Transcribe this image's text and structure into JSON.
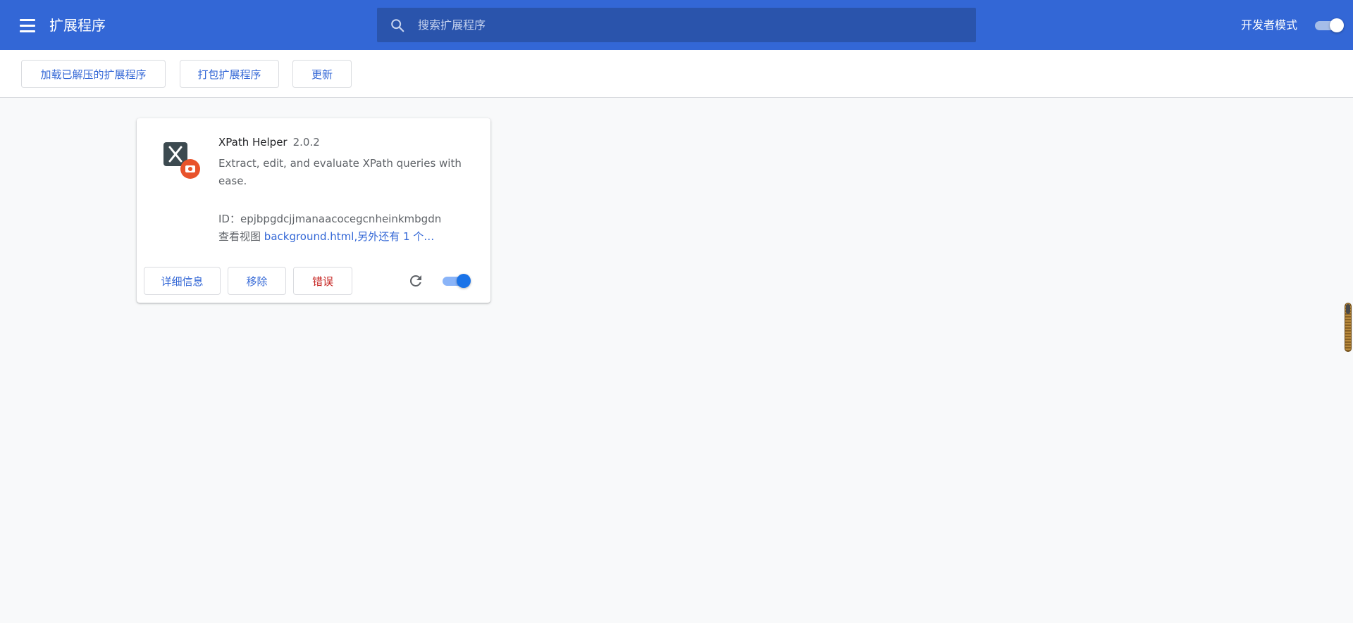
{
  "header": {
    "title": "扩展程序",
    "menu_icon": "hamburger-menu-icon",
    "search": {
      "placeholder": "搜索扩展程序",
      "value": "",
      "icon": "search-icon"
    },
    "developer_mode": {
      "label": "开发者模式",
      "enabled": true
    }
  },
  "toolbar": {
    "load_unpacked": "加载已解压的扩展程序",
    "pack_extension": "打包扩展程序",
    "update": "更新"
  },
  "extensions": [
    {
      "name": "XPath Helper",
      "version": "2.0.2",
      "description": "Extract, edit, and evaluate XPath queries with ease.",
      "id_label": "ID：",
      "id": "epjbpgdcjjmanaacocegcnheinkmbgdn",
      "views_label": "查看视图",
      "views_link": "background.html,另外还有 1 个…",
      "icon": "xpath-helper-icon",
      "enabled": true,
      "buttons": {
        "details": "详细信息",
        "remove": "移除",
        "errors": "错误"
      },
      "reload_icon": "reload-icon"
    }
  ],
  "colors": {
    "header_bg": "#3367d6",
    "search_bg": "#2a54ac",
    "accent": "#3367d6",
    "error": "#c5221f",
    "toggle_on": "#1a73e8",
    "page_bg": "#f8f9fa"
  }
}
